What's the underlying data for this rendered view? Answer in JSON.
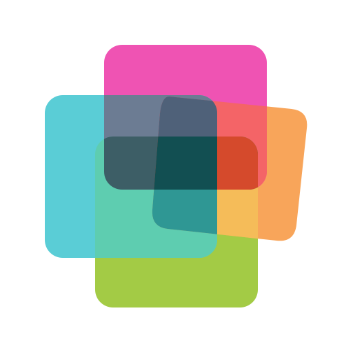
{
  "logo": {
    "background": "#ffffff",
    "tiles": [
      {
        "name": "green",
        "color": "#A3CB45"
      },
      {
        "name": "orange",
        "color": "#F8A55A"
      },
      {
        "name": "pink",
        "color": "#EF53B3"
      },
      {
        "name": "cyan",
        "color": "#5ACDD6"
      }
    ],
    "overlaps": [
      {
        "name": "pink-over-cyan",
        "color": "#6C7C93"
      },
      {
        "name": "pink-over-orange",
        "color": "#F46467"
      },
      {
        "name": "pink-cyan-orange",
        "color": "#4F6179"
      },
      {
        "name": "green-over-cyan",
        "color": "#5ECDB0"
      },
      {
        "name": "green-over-orange",
        "color": "#F5BC59"
      },
      {
        "name": "dark-band",
        "color": "#124F52"
      },
      {
        "name": "band-left",
        "color": "#3D5E66"
      },
      {
        "name": "band-right",
        "color": "#D54A2C"
      },
      {
        "name": "teal-mid",
        "color": "#2F9794"
      }
    ]
  }
}
